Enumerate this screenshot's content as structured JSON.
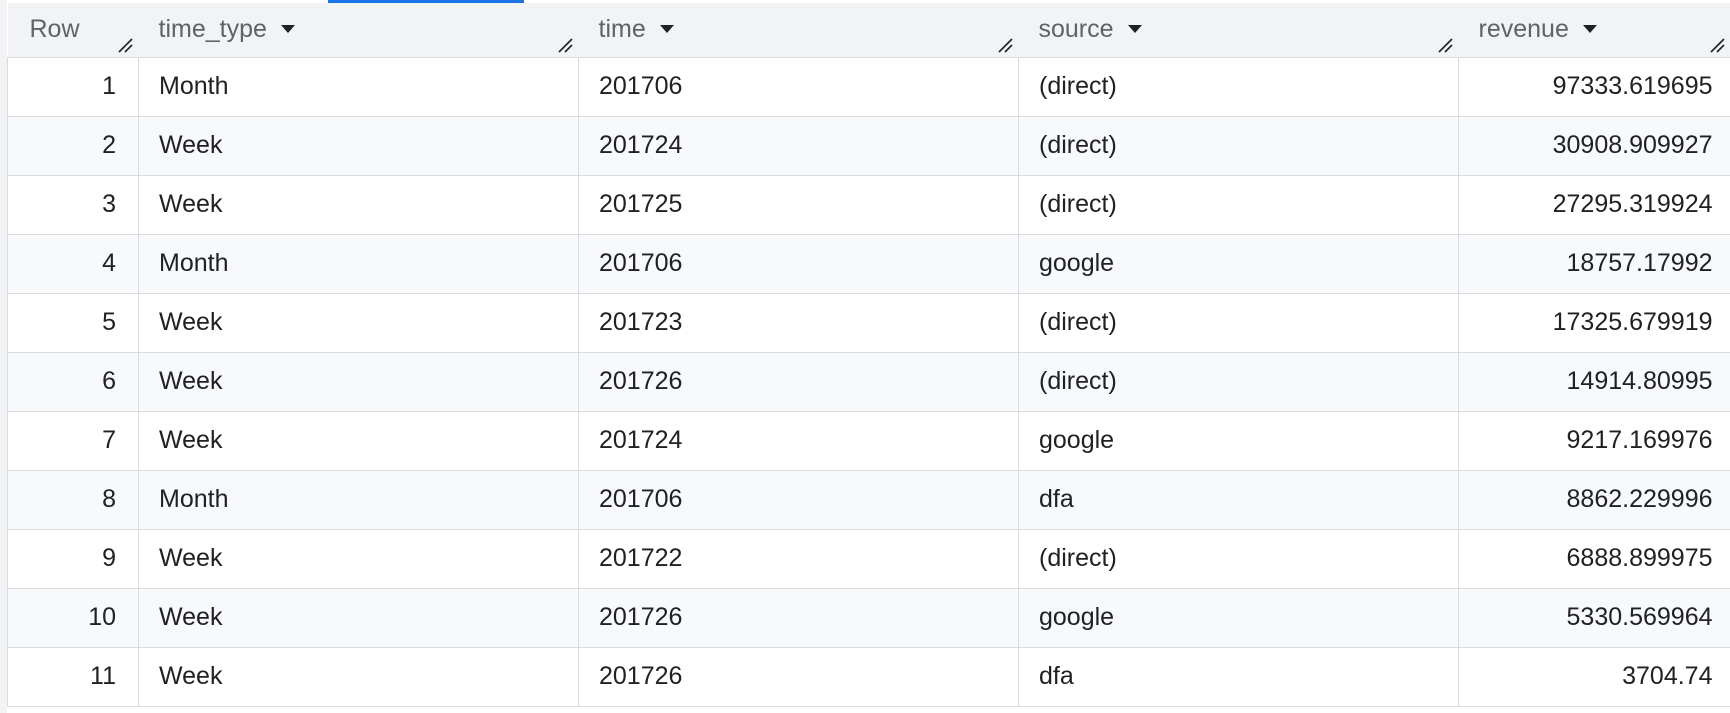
{
  "columns": {
    "row": "Row",
    "time_type": "time_type",
    "time": "time",
    "source": "source",
    "revenue": "revenue"
  },
  "icons": {
    "sort": "caret-down-icon",
    "resize": "column-resize-handle-icon"
  },
  "colors": {
    "header_bg": "#f1f3f4",
    "stripe_bg": "#f8f9fa",
    "tab_accent": "#1a73e8",
    "grid_line": "#dadce0"
  },
  "rows": [
    {
      "row": "1",
      "time_type": "Month",
      "time": "201706",
      "source": "(direct)",
      "revenue": "97333.619695"
    },
    {
      "row": "2",
      "time_type": "Week",
      "time": "201724",
      "source": "(direct)",
      "revenue": "30908.909927"
    },
    {
      "row": "3",
      "time_type": "Week",
      "time": "201725",
      "source": "(direct)",
      "revenue": "27295.319924"
    },
    {
      "row": "4",
      "time_type": "Month",
      "time": "201706",
      "source": "google",
      "revenue": "18757.17992"
    },
    {
      "row": "5",
      "time_type": "Week",
      "time": "201723",
      "source": "(direct)",
      "revenue": "17325.679919"
    },
    {
      "row": "6",
      "time_type": "Week",
      "time": "201726",
      "source": "(direct)",
      "revenue": "14914.80995"
    },
    {
      "row": "7",
      "time_type": "Week",
      "time": "201724",
      "source": "google",
      "revenue": "9217.169976"
    },
    {
      "row": "8",
      "time_type": "Month",
      "time": "201706",
      "source": "dfa",
      "revenue": "8862.229996"
    },
    {
      "row": "9",
      "time_type": "Week",
      "time": "201722",
      "source": "(direct)",
      "revenue": "6888.899975"
    },
    {
      "row": "10",
      "time_type": "Week",
      "time": "201726",
      "source": "google",
      "revenue": "5330.569964"
    },
    {
      "row": "11",
      "time_type": "Week",
      "time": "201726",
      "source": "dfa",
      "revenue": "3704.74"
    }
  ]
}
